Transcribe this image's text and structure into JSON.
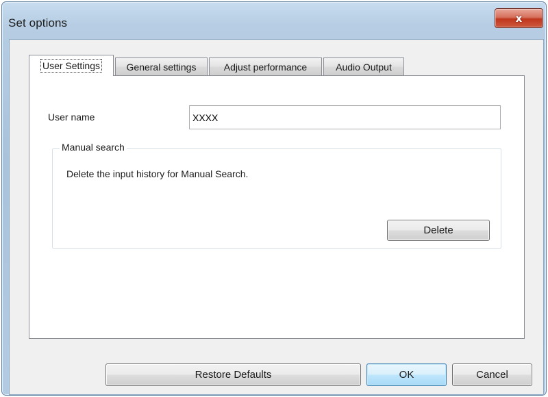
{
  "window": {
    "title": "Set options",
    "close_glyph": "x"
  },
  "tabs": [
    {
      "label": "User Settings",
      "active": true
    },
    {
      "label": "General settings",
      "active": false
    },
    {
      "label": "Adjust performance",
      "active": false
    },
    {
      "label": "Audio Output",
      "active": false
    }
  ],
  "user_settings": {
    "user_name_label": "User name",
    "user_name_value": "XXXX",
    "manual_search": {
      "legend": "Manual search",
      "description": "Delete the input history for Manual Search.",
      "delete_label": "Delete"
    }
  },
  "footer": {
    "restore_label": "Restore Defaults",
    "ok_label": "OK",
    "cancel_label": "Cancel"
  },
  "colors": {
    "frame": "#a9c3dc",
    "close_button": "#c0371d",
    "default_button_border": "#3c7fb1"
  }
}
